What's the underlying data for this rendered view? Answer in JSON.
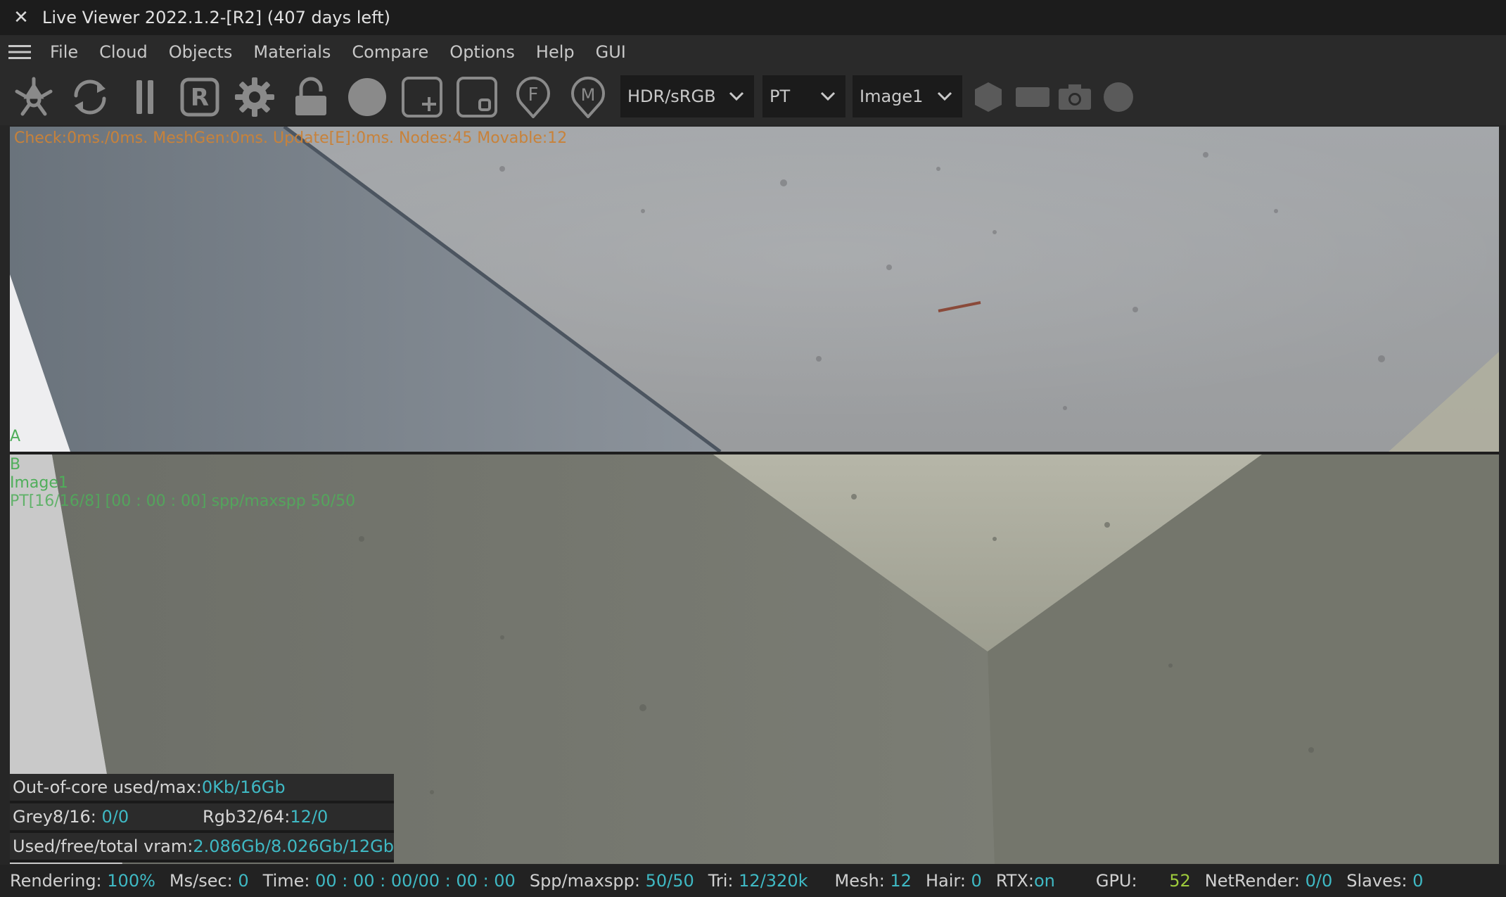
{
  "window": {
    "title": "Live Viewer 2022.1.2-[R2] (407 days left)",
    "close_glyph": "✕"
  },
  "menu": {
    "items": [
      "File",
      "Cloud",
      "Objects",
      "Materials",
      "Compare",
      "Options",
      "Help",
      "GUI"
    ]
  },
  "toolbar": {
    "icons": [
      "send-scene-icon",
      "restart-icon",
      "pause-icon",
      "region-render-icon",
      "settings-gear-icon",
      "lock-icon",
      "material-ball-icon",
      "add-compare-icon",
      "save-compare-icon",
      "focus-picker-icon",
      "material-picker-icon"
    ],
    "dropdowns": [
      {
        "value": "HDR/sRGB"
      },
      {
        "value": "PT"
      },
      {
        "value": "Image1"
      }
    ],
    "right_icons": [
      "hexagon-icon",
      "rectangle-icon",
      "camera-icon",
      "circle-icon"
    ]
  },
  "viewport": {
    "check_line": "Check:0ms./0ms. MeshGen:0ms. Update[E]:0ms. Nodes:45 Movable:12",
    "pane_a_label": "A",
    "pane_b_label": "B",
    "image_label": "Image1",
    "render_info": "PT[16/16/8] [00 : 00 : 00] spp/maxspp 50/50"
  },
  "stats": {
    "out_of_core_label": "Out-of-core used/max:",
    "out_of_core_value": "0Kb/16Gb",
    "grey_label": "Grey8/16: ",
    "grey_value": "0/0",
    "rgb_label": "Rgb32/64: ",
    "rgb_value": "12/0",
    "vram_label": "Used/free/total vram: ",
    "vram_value": "2.086Gb/8.026Gb/12Gb"
  },
  "status": {
    "rendering_label": "Rendering: ",
    "rendering_value": "100%",
    "ms_label": "Ms/sec: ",
    "ms_value": "0",
    "time_label": "Time: ",
    "time_value": "00 : 00 : 00/00 : 00 : 00",
    "spp_label": "Spp/maxspp: ",
    "spp_value": "50/50",
    "tri_label": "Tri: ",
    "tri_value": "12/320k",
    "mesh_label": "Mesh: ",
    "mesh_value": "12",
    "hair_label": "Hair: ",
    "hair_value": "0",
    "rtx_label": "RTX:",
    "rtx_value": "on",
    "gpu_label": "GPU: ",
    "gpu_value": "52",
    "netrender_label": "NetRender: ",
    "netrender_value": "0/0",
    "slaves_label": "Slaves: ",
    "slaves_value": "0"
  },
  "colors": {
    "accent_value": "#3fb9c4",
    "check_text": "#c8823a",
    "overlay_green": "#4fae5a",
    "gpu_value": "#9ecb3c"
  }
}
